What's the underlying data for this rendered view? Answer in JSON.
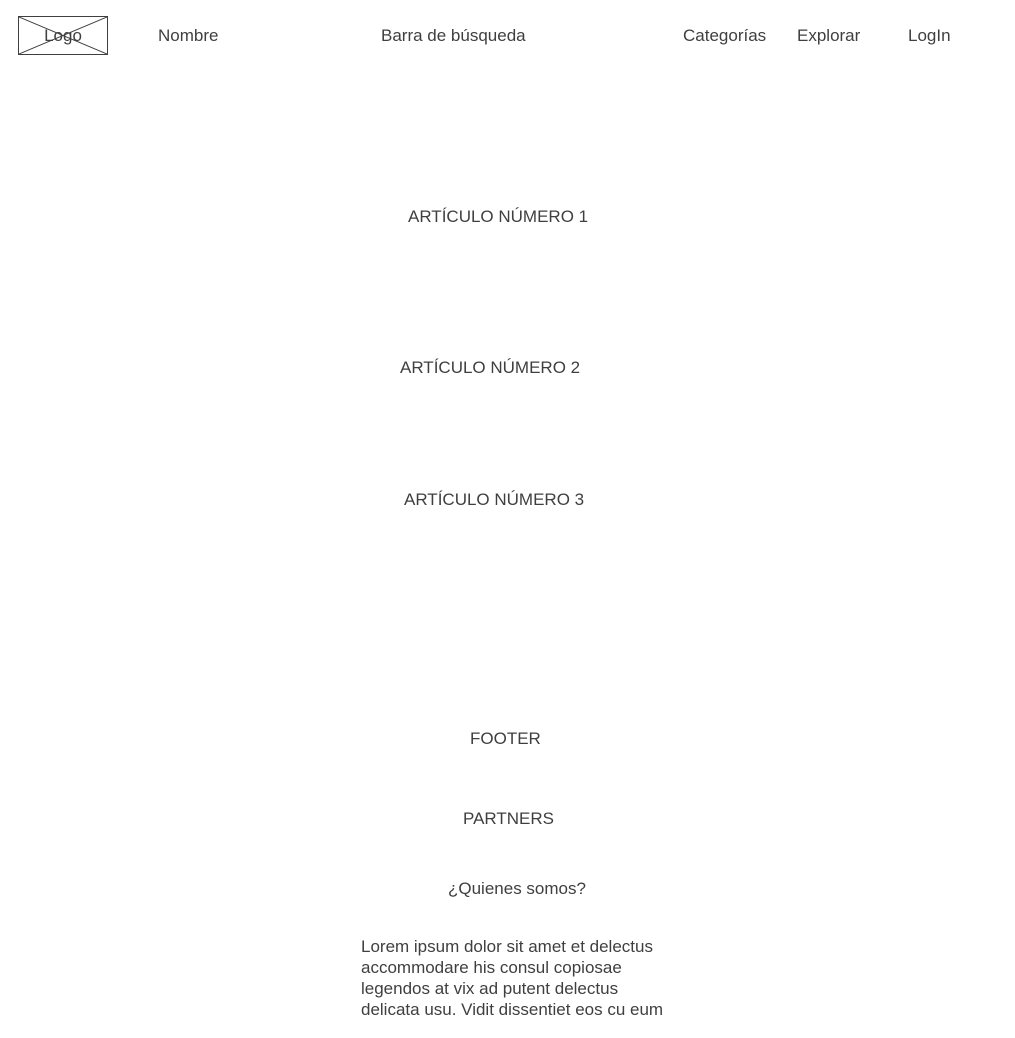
{
  "header": {
    "logo_label": "Logo",
    "name_label": "Nombre",
    "search_label": "Barra de búsqueda",
    "nav": {
      "categories": "Categorías",
      "explore": "Explorar",
      "login": "LogIn"
    }
  },
  "articles": [
    {
      "title": "ARTÍCULO NÚMERO 1"
    },
    {
      "title": "ARTÍCULO NÚMERO 2"
    },
    {
      "title": "ARTÍCULO NÚMERO 3"
    }
  ],
  "footer": {
    "title": "FOOTER",
    "partners": "PARTNERS",
    "about_heading": "¿Quienes somos?",
    "about_lines": [
      "Lorem ipsum dolor sit amet et delectus",
      "accommodare his consul copiosae",
      "legendos at vix ad putent delectus",
      "delicata usu. Vidit dissentiet eos cu eum"
    ]
  }
}
